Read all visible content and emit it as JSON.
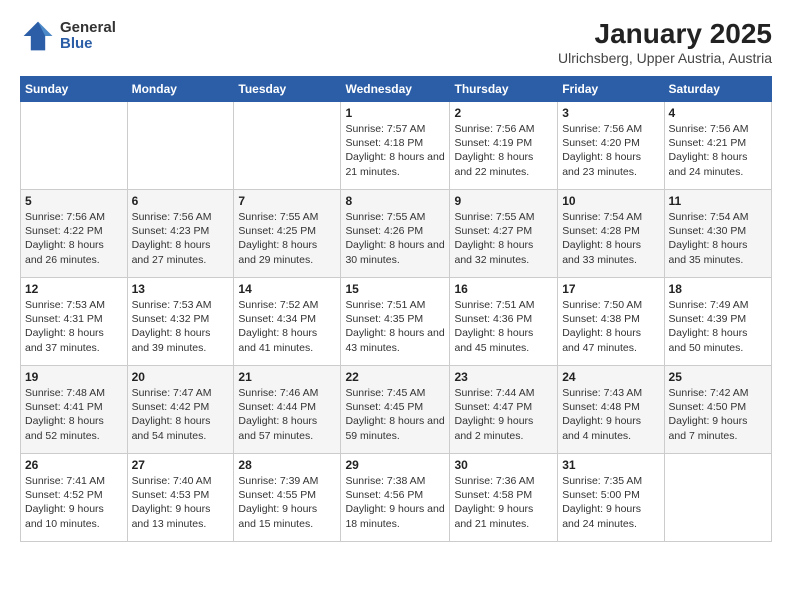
{
  "logo": {
    "general": "General",
    "blue": "Blue"
  },
  "title": "January 2025",
  "subtitle": "Ulrichsberg, Upper Austria, Austria",
  "weekdays": [
    "Sunday",
    "Monday",
    "Tuesday",
    "Wednesday",
    "Thursday",
    "Friday",
    "Saturday"
  ],
  "weeks": [
    [
      {
        "day": "",
        "content": ""
      },
      {
        "day": "",
        "content": ""
      },
      {
        "day": "",
        "content": ""
      },
      {
        "day": "1",
        "content": "Sunrise: 7:57 AM\nSunset: 4:18 PM\nDaylight: 8 hours and 21 minutes."
      },
      {
        "day": "2",
        "content": "Sunrise: 7:56 AM\nSunset: 4:19 PM\nDaylight: 8 hours and 22 minutes."
      },
      {
        "day": "3",
        "content": "Sunrise: 7:56 AM\nSunset: 4:20 PM\nDaylight: 8 hours and 23 minutes."
      },
      {
        "day": "4",
        "content": "Sunrise: 7:56 AM\nSunset: 4:21 PM\nDaylight: 8 hours and 24 minutes."
      }
    ],
    [
      {
        "day": "5",
        "content": "Sunrise: 7:56 AM\nSunset: 4:22 PM\nDaylight: 8 hours and 26 minutes."
      },
      {
        "day": "6",
        "content": "Sunrise: 7:56 AM\nSunset: 4:23 PM\nDaylight: 8 hours and 27 minutes."
      },
      {
        "day": "7",
        "content": "Sunrise: 7:55 AM\nSunset: 4:25 PM\nDaylight: 8 hours and 29 minutes."
      },
      {
        "day": "8",
        "content": "Sunrise: 7:55 AM\nSunset: 4:26 PM\nDaylight: 8 hours and 30 minutes."
      },
      {
        "day": "9",
        "content": "Sunrise: 7:55 AM\nSunset: 4:27 PM\nDaylight: 8 hours and 32 minutes."
      },
      {
        "day": "10",
        "content": "Sunrise: 7:54 AM\nSunset: 4:28 PM\nDaylight: 8 hours and 33 minutes."
      },
      {
        "day": "11",
        "content": "Sunrise: 7:54 AM\nSunset: 4:30 PM\nDaylight: 8 hours and 35 minutes."
      }
    ],
    [
      {
        "day": "12",
        "content": "Sunrise: 7:53 AM\nSunset: 4:31 PM\nDaylight: 8 hours and 37 minutes."
      },
      {
        "day": "13",
        "content": "Sunrise: 7:53 AM\nSunset: 4:32 PM\nDaylight: 8 hours and 39 minutes."
      },
      {
        "day": "14",
        "content": "Sunrise: 7:52 AM\nSunset: 4:34 PM\nDaylight: 8 hours and 41 minutes."
      },
      {
        "day": "15",
        "content": "Sunrise: 7:51 AM\nSunset: 4:35 PM\nDaylight: 8 hours and 43 minutes."
      },
      {
        "day": "16",
        "content": "Sunrise: 7:51 AM\nSunset: 4:36 PM\nDaylight: 8 hours and 45 minutes."
      },
      {
        "day": "17",
        "content": "Sunrise: 7:50 AM\nSunset: 4:38 PM\nDaylight: 8 hours and 47 minutes."
      },
      {
        "day": "18",
        "content": "Sunrise: 7:49 AM\nSunset: 4:39 PM\nDaylight: 8 hours and 50 minutes."
      }
    ],
    [
      {
        "day": "19",
        "content": "Sunrise: 7:48 AM\nSunset: 4:41 PM\nDaylight: 8 hours and 52 minutes."
      },
      {
        "day": "20",
        "content": "Sunrise: 7:47 AM\nSunset: 4:42 PM\nDaylight: 8 hours and 54 minutes."
      },
      {
        "day": "21",
        "content": "Sunrise: 7:46 AM\nSunset: 4:44 PM\nDaylight: 8 hours and 57 minutes."
      },
      {
        "day": "22",
        "content": "Sunrise: 7:45 AM\nSunset: 4:45 PM\nDaylight: 8 hours and 59 minutes."
      },
      {
        "day": "23",
        "content": "Sunrise: 7:44 AM\nSunset: 4:47 PM\nDaylight: 9 hours and 2 minutes."
      },
      {
        "day": "24",
        "content": "Sunrise: 7:43 AM\nSunset: 4:48 PM\nDaylight: 9 hours and 4 minutes."
      },
      {
        "day": "25",
        "content": "Sunrise: 7:42 AM\nSunset: 4:50 PM\nDaylight: 9 hours and 7 minutes."
      }
    ],
    [
      {
        "day": "26",
        "content": "Sunrise: 7:41 AM\nSunset: 4:52 PM\nDaylight: 9 hours and 10 minutes."
      },
      {
        "day": "27",
        "content": "Sunrise: 7:40 AM\nSunset: 4:53 PM\nDaylight: 9 hours and 13 minutes."
      },
      {
        "day": "28",
        "content": "Sunrise: 7:39 AM\nSunset: 4:55 PM\nDaylight: 9 hours and 15 minutes."
      },
      {
        "day": "29",
        "content": "Sunrise: 7:38 AM\nSunset: 4:56 PM\nDaylight: 9 hours and 18 minutes."
      },
      {
        "day": "30",
        "content": "Sunrise: 7:36 AM\nSunset: 4:58 PM\nDaylight: 9 hours and 21 minutes."
      },
      {
        "day": "31",
        "content": "Sunrise: 7:35 AM\nSunset: 5:00 PM\nDaylight: 9 hours and 24 minutes."
      },
      {
        "day": "",
        "content": ""
      }
    ]
  ]
}
